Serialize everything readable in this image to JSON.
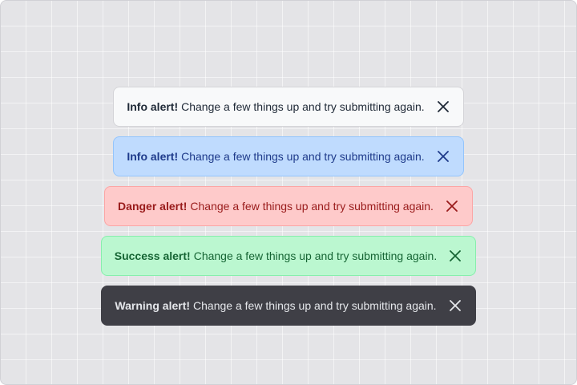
{
  "alerts": [
    {
      "variant": "light",
      "strong": "Info alert!",
      "message": "Change a few things up and try submitting again.",
      "close_icon": "close-icon",
      "colors": {
        "background": "#f8f9fa",
        "text": "#1f2937",
        "border": "#d4d4d8"
      }
    },
    {
      "variant": "info",
      "strong": "Info alert!",
      "message": "Change a few things up and try submitting again.",
      "close_icon": "close-icon",
      "colors": {
        "background": "#bfdbfe",
        "text": "#1e3a8a",
        "border": "#93c5fd"
      }
    },
    {
      "variant": "danger",
      "strong": "Danger alert!",
      "message": "Change a few things up and try submitting again.",
      "close_icon": "close-icon",
      "colors": {
        "background": "#fecaca",
        "text": "#991b1b",
        "border": "#fca5a5"
      }
    },
    {
      "variant": "success",
      "strong": "Success alert!",
      "message": "Change a few things up and try submitting again.",
      "close_icon": "close-icon",
      "colors": {
        "background": "#bbf7d0",
        "text": "#166534",
        "border": "#86efac"
      }
    },
    {
      "variant": "dark",
      "strong": "Warning alert!",
      "message": "Change a few things up and try submitting again.",
      "close_icon": "close-icon",
      "colors": {
        "background": "#3f3f46",
        "text": "#e5e7eb",
        "border": "#3f3f46"
      }
    }
  ]
}
